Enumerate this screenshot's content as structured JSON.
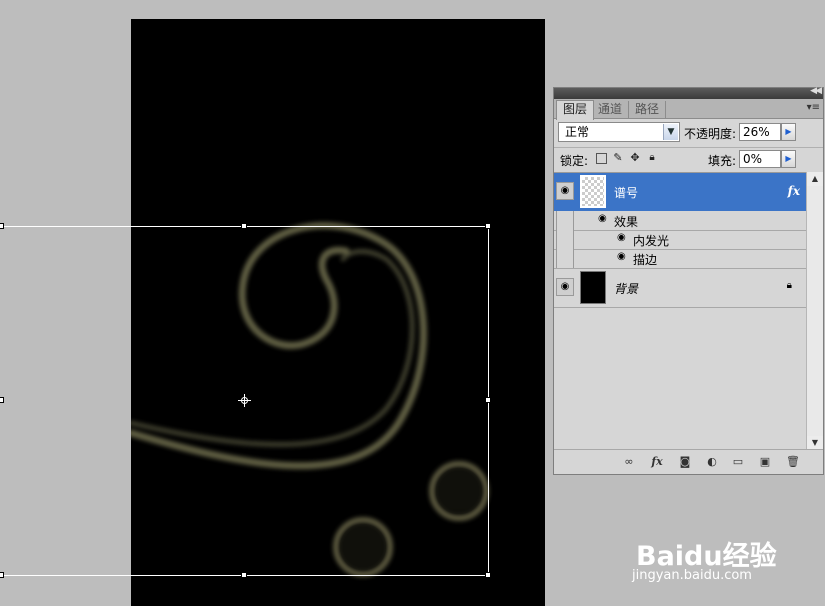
{
  "canvas": {
    "background": "#000000",
    "glow_color": "#6f6d4e"
  },
  "layers_panel": {
    "tabs": [
      {
        "label": "图层",
        "active": true
      },
      {
        "label": "通道",
        "active": false
      },
      {
        "label": "路径",
        "active": false
      }
    ],
    "blend_mode": "正常",
    "opacity_label": "不透明度:",
    "opacity_value": "26%",
    "lock_label": "锁定:",
    "fill_label": "填充:",
    "fill_value": "0%",
    "layers": [
      {
        "name": "谱号",
        "selected": true,
        "has_fx": true,
        "fx_badge": "fx",
        "effects_label": "效果",
        "effects": [
          "内发光",
          "描边"
        ]
      },
      {
        "name": "背景",
        "selected": false,
        "locked": true
      }
    ],
    "icons": {
      "panel_menu": "panel-menu-icon",
      "eye": "eye-icon",
      "lock_transparent": "lock-transparent-pixels-icon",
      "lock_image": "lock-image-pixels-icon",
      "lock_position": "lock-position-icon",
      "lock_all": "lock-all-icon",
      "link": "link-layers-icon",
      "fx": "add-layer-style-icon",
      "mask": "add-mask-icon",
      "adjustment": "new-adjustment-layer-icon",
      "group": "new-group-icon",
      "new_layer": "new-layer-icon",
      "trash": "delete-layer-icon"
    },
    "selected_color": "#3b74c7"
  },
  "watermark": {
    "brand": "Baidu经验",
    "url": "jingyan.baidu.com"
  }
}
